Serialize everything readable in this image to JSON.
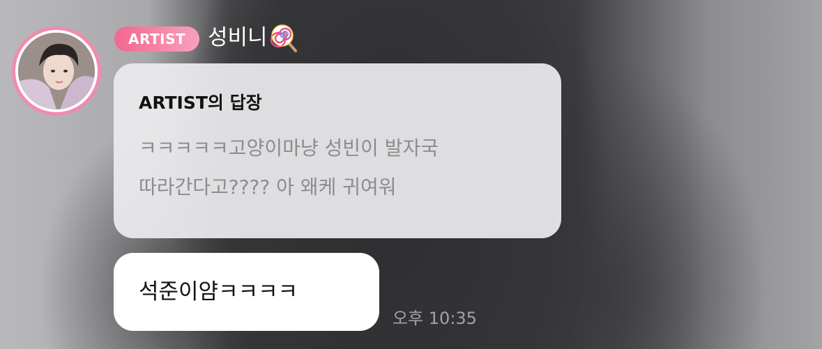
{
  "sender": {
    "badge": "ARTIST",
    "name": "성비니"
  },
  "reply": {
    "header": "ARTIST의 답장",
    "lines": [
      "ㅋㅋㅋㅋㅋ고양이마냥 성빈이 발자국",
      "따라간다고???? 아 왜케 귀여워"
    ]
  },
  "message": {
    "text": "석준이얌ㅋㅋㅋㅋ",
    "time": "오후 10:35"
  },
  "colors": {
    "badge": "#f3668f",
    "avatar_ring": "#f08bb0",
    "reply_bubble": "#ececee",
    "message_bubble": "#ffffff"
  }
}
